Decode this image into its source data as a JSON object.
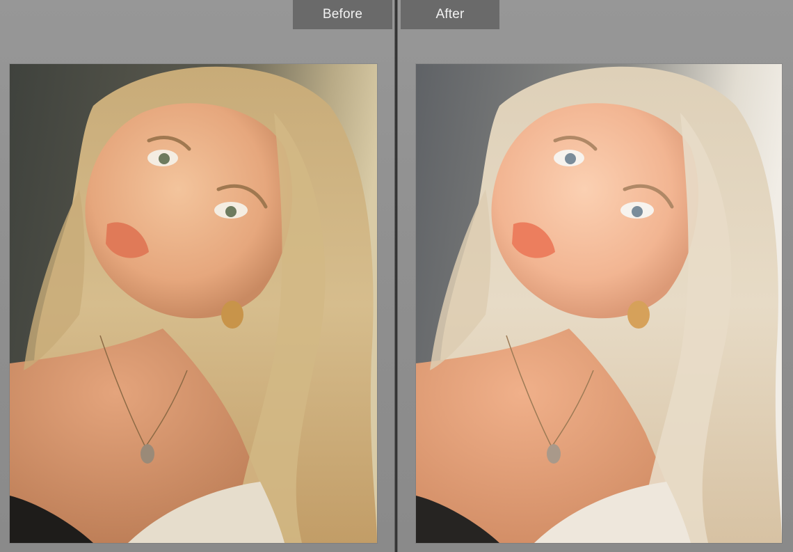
{
  "tabs": {
    "before_label": "Before",
    "after_label": "After"
  },
  "photos": {
    "before": {
      "name": "before-photo",
      "tone": "warm-original"
    },
    "after": {
      "name": "after-photo",
      "tone": "bright-edited"
    }
  },
  "colors": {
    "tab_bg": "#6a6a6a",
    "tab_text": "#f2f2f2",
    "panel_bg": "#8f8f8f",
    "divider": "#2a2a2a"
  }
}
